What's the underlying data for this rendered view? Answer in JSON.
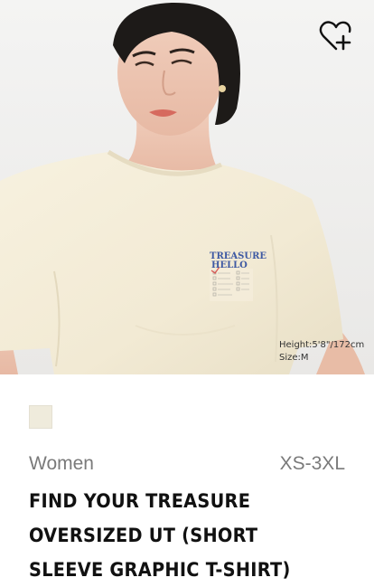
{
  "product": {
    "model_info": {
      "height": "Height:5'8\"/172cm",
      "size": "Size:M"
    },
    "print": {
      "line1": "TREASURE",
      "line2": "HELLO"
    },
    "color_swatch": "#efebdc",
    "gender": "Women",
    "size_range": "XS-3XL",
    "name_lines": [
      "FIND YOUR TREASURE",
      "OVERSIZED UT (SHORT",
      "SLEEVE GRAPHIC T-SHIRT)"
    ]
  },
  "icons": {
    "wishlist": "heart-plus-icon"
  }
}
